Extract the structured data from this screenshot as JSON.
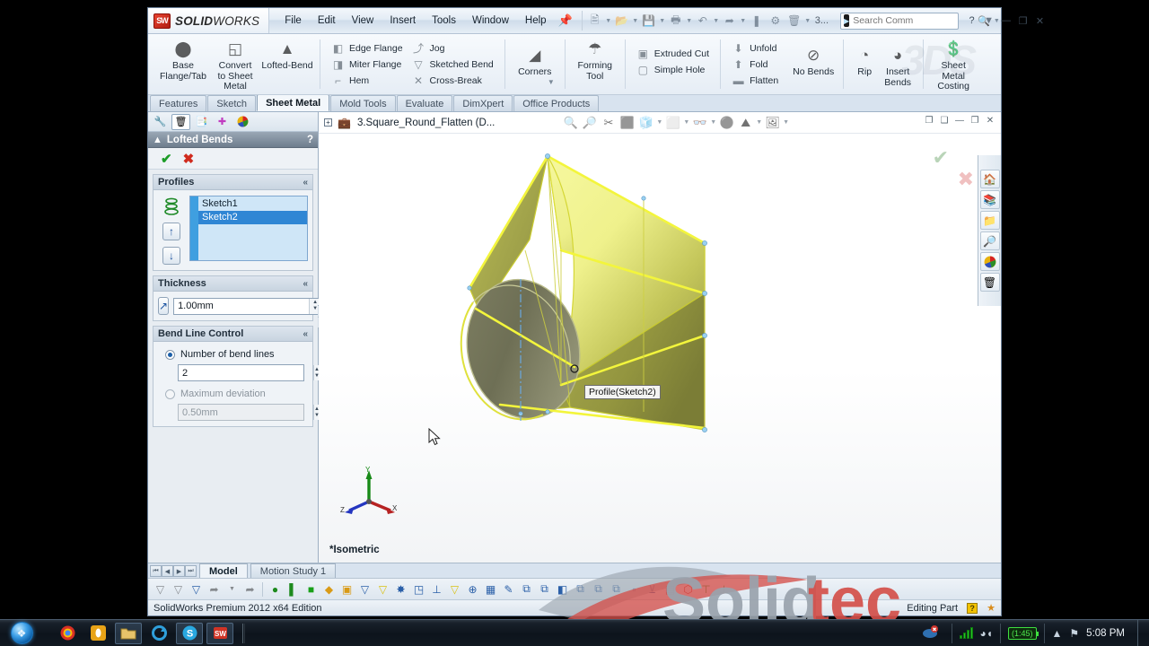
{
  "window": {
    "app_name_bold": "SOLID",
    "app_name_light": "WORKS",
    "logo_mark": "SW",
    "menus": [
      "File",
      "Edit",
      "View",
      "Insert",
      "Tools",
      "Window",
      "Help"
    ],
    "pin_icon": "pin-icon",
    "quick_access": [
      {
        "name": "new-document-icon",
        "glyph": "⬜",
        "caret": true
      },
      {
        "name": "open-document-icon",
        "glyph": "📂",
        "caret": true
      },
      {
        "name": "save-icon",
        "glyph": "💾",
        "caret": true
      },
      {
        "name": "print-icon",
        "glyph": "🖨",
        "caret": true
      },
      {
        "name": "undo-icon",
        "glyph": "↶",
        "caret": true
      },
      {
        "name": "select-icon",
        "glyph": "↖",
        "caret": true
      },
      {
        "name": "rebuild-icon",
        "glyph": "❚",
        "caret": false
      },
      {
        "name": "options-icon",
        "glyph": "⚙",
        "caret": false
      },
      {
        "name": "document-properties-icon",
        "glyph": "🗒",
        "caret": true
      }
    ],
    "qat_overflow": "3...",
    "search": {
      "placeholder": "Search Comm",
      "icon": "command-search-icon",
      "magnifier": "magnifier-icon",
      "caret": "chevron-down-icon"
    },
    "help_icon": "help-icon",
    "controls": {
      "minimize": "—",
      "restore": "❐",
      "close": "✕"
    }
  },
  "ribbon": {
    "watermark": "3DS",
    "groups": [
      {
        "type": "big",
        "buttons": [
          {
            "label": "Base\nFlange/Tab",
            "icon": "base-flange-tab-icon",
            "glyph": "⏺"
          },
          {
            "label": "Convert\nto Sheet\nMetal",
            "icon": "convert-to-sheet-metal-icon",
            "glyph": "◱"
          },
          {
            "label": "Lofted-Bend",
            "icon": "lofted-bend-icon",
            "glyph": "▲"
          }
        ]
      },
      {
        "type": "small",
        "columns": [
          [
            {
              "label": "Edge Flange",
              "icon": "edge-flange-icon",
              "glyph": "◧"
            },
            {
              "label": "Miter Flange",
              "icon": "miter-flange-icon",
              "glyph": "◨"
            },
            {
              "label": "Hem",
              "icon": "hem-icon",
              "glyph": "⌐"
            }
          ],
          [
            {
              "label": "Jog",
              "icon": "jog-icon",
              "glyph": "⤴"
            },
            {
              "label": "Sketched Bend",
              "icon": "sketched-bend-icon",
              "glyph": "▽"
            },
            {
              "label": "Cross-Break",
              "icon": "cross-break-icon",
              "glyph": "✕"
            }
          ]
        ]
      },
      {
        "type": "big",
        "buttons": [
          {
            "label": "Corners",
            "icon": "corners-icon",
            "glyph": "◢"
          }
        ],
        "dropdown": true
      },
      {
        "type": "big",
        "buttons": [
          {
            "label": "Forming\nTool",
            "icon": "forming-tool-icon",
            "glyph": "☂"
          }
        ]
      },
      {
        "type": "small",
        "columns": [
          [
            {
              "label": "Extruded Cut",
              "icon": "extruded-cut-icon",
              "glyph": "▣"
            },
            {
              "label": "Simple Hole",
              "icon": "simple-hole-icon",
              "glyph": "▢"
            }
          ]
        ]
      },
      {
        "type": "small",
        "columns": [
          [
            {
              "label": "Unfold",
              "icon": "unfold-icon",
              "glyph": "⬇"
            },
            {
              "label": "Fold",
              "icon": "fold-icon",
              "glyph": "⬆"
            },
            {
              "label": "Flatten",
              "icon": "flatten-icon",
              "glyph": "▬"
            }
          ]
        ]
      },
      {
        "type": "big",
        "buttons": [
          {
            "label": "No Bends",
            "icon": "no-bends-icon",
            "glyph": "⊘"
          }
        ]
      },
      {
        "type": "big",
        "buttons": [
          {
            "label": "Rip",
            "icon": "rip-icon",
            "glyph": "◔"
          },
          {
            "label": "Insert\nBends",
            "icon": "insert-bends-icon",
            "glyph": "◕"
          }
        ]
      },
      {
        "type": "big",
        "buttons": [
          {
            "label": "Sheet\nMetal\nCosting",
            "icon": "sheet-metal-costing-icon",
            "glyph": "💲"
          }
        ]
      }
    ]
  },
  "command_tabs": {
    "items": [
      "Features",
      "Sketch",
      "Sheet Metal",
      "Mold Tools",
      "Evaluate",
      "DimXpert",
      "Office Products"
    ],
    "active": "Sheet Metal"
  },
  "property_manager": {
    "tabs": [
      {
        "name": "feature-manager-tab",
        "glyph": "🔧",
        "active": false
      },
      {
        "name": "property-manager-tab",
        "glyph": "🗒",
        "active": true
      },
      {
        "name": "configuration-manager-tab",
        "glyph": "📑",
        "active": false
      },
      {
        "name": "dimxpert-manager-tab",
        "glyph": "⊕",
        "active": false
      },
      {
        "name": "display-manager-tab",
        "glyph": "🎨",
        "active": false
      }
    ],
    "title": "Lofted Bends",
    "title_icon": "lofted-bends-icon",
    "help": "?",
    "ok_label": "✔",
    "cancel_label": "✖",
    "sections": {
      "profiles": {
        "title": "Profiles",
        "collapse": "«",
        "items": [
          {
            "label": "Sketch1",
            "selected": false
          },
          {
            "label": "Sketch2",
            "selected": true
          }
        ],
        "move_up": "↑",
        "move_down": "↓"
      },
      "thickness": {
        "title": "Thickness",
        "collapse": "«",
        "value": "1.00mm",
        "icon": "thickness-direction-icon"
      },
      "bend_line_control": {
        "title": "Bend Line Control",
        "collapse": "«",
        "option_number_label": "Number of bend lines",
        "option_number_selected": true,
        "number_value": "2",
        "option_deviation_label": "Maximum deviation",
        "option_deviation_selected": false,
        "deviation_value": "0.50mm"
      }
    }
  },
  "graphics": {
    "doc_name": "3.Square_Round_Flatten  (D...",
    "doc_icon": "sheet-metal-part-icon",
    "expand_icon": "expand-tree-icon",
    "view_tools": [
      {
        "name": "zoom-to-fit-icon",
        "glyph": "🔍",
        "caret": false
      },
      {
        "name": "zoom-to-area-icon",
        "glyph": "🔎",
        "caret": false
      },
      {
        "name": "section-view-icon",
        "glyph": "✂",
        "caret": false
      },
      {
        "name": "view-orientation-icon",
        "glyph": "⬛",
        "caret": false
      },
      {
        "name": "view-orientation-cube-icon",
        "glyph": "🧊",
        "caret": true
      },
      {
        "name": "display-style-icon",
        "glyph": "⬜",
        "caret": true
      },
      {
        "name": "hide-show-items-icon",
        "glyph": "👓",
        "caret": true
      },
      {
        "name": "edit-appearance-icon",
        "glyph": "⚫",
        "caret": false
      },
      {
        "name": "apply-scene-icon",
        "glyph": "⛰",
        "caret": true
      },
      {
        "name": "view-settings-icon",
        "glyph": "🖼",
        "caret": true
      }
    ],
    "window_controls": {
      "restore_down": "❐",
      "split_h": "❑",
      "minimize": "—",
      "maximize": "❐",
      "close": "✕"
    },
    "confirm_ok": "✔",
    "confirm_cancel": "✖",
    "tooltip": "Profile(Sketch2)",
    "view_label": "*Isometric",
    "triad": {
      "x": "X",
      "y": "Y",
      "z": "Z",
      "x_color": "#c02020",
      "y_color": "#0f8f0f",
      "z_color": "#2030c0"
    },
    "model": {
      "body_color": "#d7d96a",
      "highlight_color": "#f2f43a",
      "shadow_color": "#6a6a48"
    }
  },
  "task_pane": [
    {
      "name": "sw-resources-icon",
      "glyph": "🏠"
    },
    {
      "name": "design-library-icon",
      "glyph": "📚"
    },
    {
      "name": "file-explorer-icon",
      "glyph": "📁"
    },
    {
      "name": "search-icon",
      "glyph": "🔎"
    },
    {
      "name": "appearances-scenes-icon",
      "glyph": "🎨"
    },
    {
      "name": "custom-properties-icon",
      "glyph": "🗒"
    }
  ],
  "bottom": {
    "nav": [
      "⏮",
      "◀",
      "▶",
      "⏭"
    ],
    "tabs": [
      {
        "label": "Model",
        "active": true
      },
      {
        "label": "Motion Study 1",
        "active": false
      }
    ],
    "toolbar_icons": [
      {
        "name": "filter-icon",
        "glyph": "▽",
        "dim": true
      },
      {
        "name": "filter-faces-icon",
        "glyph": "▽",
        "dim": true
      },
      {
        "name": "filter-edges-icon",
        "glyph": "▽",
        "dim": false
      },
      {
        "name": "select-arrow-icon",
        "glyph": "↖",
        "dim": true
      },
      {
        "name": "select-dropdown-icon",
        "glyph": "▾",
        "dim": true
      },
      {
        "name": "select-other-icon",
        "glyph": "↖",
        "dim": true
      },
      {
        "name": "filter-vertices-icon",
        "glyph": "●",
        "dim": false
      },
      {
        "name": "filter-axes-icon",
        "glyph": "▕",
        "dim": false
      },
      {
        "name": "filter-faces2-icon",
        "glyph": "■",
        "dim": false
      },
      {
        "name": "filter-surface-icon",
        "glyph": "◆",
        "dim": false
      },
      {
        "name": "filter-solid-icon",
        "glyph": "▣",
        "dim": false
      },
      {
        "name": "filter-sketch-icon",
        "glyph": "▽",
        "dim": false
      },
      {
        "name": "filter-sketch-point-icon",
        "glyph": "▽",
        "dim": false
      },
      {
        "name": "filter-midpoint-icon",
        "glyph": "✸",
        "dim": false
      },
      {
        "name": "filter-weld-icon",
        "glyph": "◳",
        "dim": false
      },
      {
        "name": "filter-dimension-icon",
        "glyph": "⊥",
        "dim": false
      },
      {
        "name": "filter-annotation-icon",
        "glyph": "▽",
        "dim": false
      },
      {
        "name": "filter-plane-icon",
        "glyph": "⊕",
        "dim": false
      },
      {
        "name": "filter-component-icon",
        "glyph": "▦",
        "dim": false
      },
      {
        "name": "filter-mate-icon",
        "glyph": "✐",
        "dim": false
      },
      {
        "name": "filter-feature-icon",
        "glyph": "↗",
        "dim": false
      },
      {
        "name": "filter-cosmetic-icon",
        "glyph": "▧",
        "dim": false
      },
      {
        "name": "filter-hole-icon",
        "glyph": "◎",
        "dim": false
      },
      {
        "name": "filter-note-icon",
        "glyph": "Ⓐ",
        "dim": false
      },
      {
        "name": "filter-balloon-icon",
        "glyph": "✡",
        "dim": false
      },
      {
        "name": "filter-weldment-icon",
        "glyph": "⚙",
        "dim": false
      },
      {
        "name": "filter-block-icon",
        "glyph": "▱",
        "dim": false
      },
      {
        "name": "filter-datum-icon",
        "glyph": "⊻",
        "dim": false
      },
      {
        "name": "filter-tolerance-icon",
        "glyph": "▤",
        "dim": false
      },
      {
        "name": "filter-gtol-icon",
        "glyph": "⬡",
        "dim": false
      },
      {
        "name": "filter-centerline-icon",
        "glyph": "⊤",
        "dim": false
      },
      {
        "name": "filter-centermark-icon",
        "glyph": "⊥",
        "dim": false
      }
    ],
    "status_left": "SolidWorks Premium 2012 x64 Edition",
    "status_right": "Editing Part",
    "status_warn": "?",
    "status_tag_icon": "tag-icon"
  },
  "watermark": {
    "text": "Solidtec"
  },
  "taskbar": {
    "start": "start-orb",
    "items": [
      {
        "name": "chrome-taskbar-icon",
        "glyph": "◉",
        "open": false
      },
      {
        "name": "opera-taskbar-icon",
        "glyph": "●",
        "open": false
      },
      {
        "name": "explorer-taskbar-icon",
        "glyph": "📁",
        "open": true
      },
      {
        "name": "refresh-taskbar-icon",
        "glyph": "⟳",
        "open": false
      },
      {
        "name": "skype-taskbar-icon",
        "glyph": "S",
        "open": true
      },
      {
        "name": "solidworks-taskbar-icon",
        "glyph": "SW",
        "open": true
      }
    ],
    "tray": {
      "app_icon": "tray-app-icon",
      "signal_icon": "signal-bars-icon",
      "wifi_icon": "wifi-icon",
      "battery_label": "(1:45)",
      "overflow_icon": "▲",
      "flag_icon": "⚑",
      "clock": "5:08 PM"
    }
  }
}
